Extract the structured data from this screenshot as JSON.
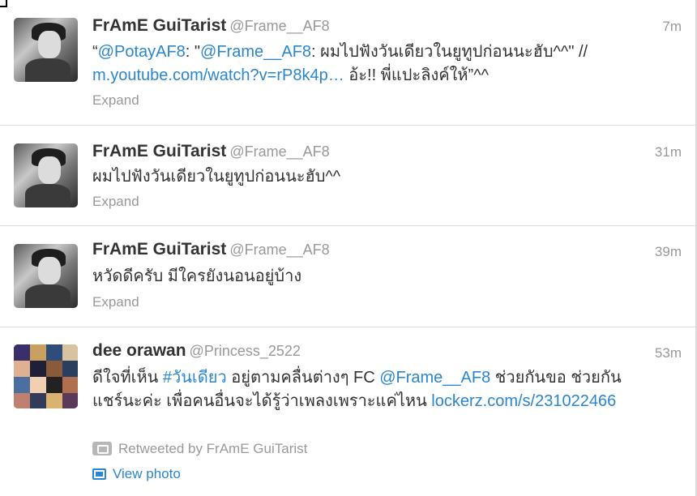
{
  "tweets": [
    {
      "name": "FrAmE GuiTarist",
      "handle": "@Frame__AF8",
      "time": "7m",
      "parts": [
        {
          "t": "“",
          "link": false
        },
        {
          "t": "@PotayAF8",
          "link": true
        },
        {
          "t": ": \"",
          "link": false
        },
        {
          "t": "@Frame__AF8",
          "link": true
        },
        {
          "t": ": ผมไปฟังวันเดียวในยูทูปก่อนนะฮับ^^\" // ",
          "link": false
        },
        {
          "t": "m.youtube.com/watch?v=rP8k4p…",
          "link": true
        },
        {
          "t": " อ้ะ!! พี่แปะลิงค์ให้”^^",
          "link": false
        }
      ],
      "expand": "Expand"
    },
    {
      "name": "FrAmE GuiTarist",
      "handle": "@Frame__AF8",
      "time": "31m",
      "parts": [
        {
          "t": "ผมไปฟังวันเดียวในยูทูปก่อนนะฮับ^^",
          "link": false
        }
      ],
      "expand": "Expand"
    },
    {
      "name": "FrAmE GuiTarist",
      "handle": "@Frame__AF8",
      "time": "39m",
      "parts": [
        {
          "t": "หวัดดีครับ มีใครยังนอนอยู่บ้าง",
          "link": false
        }
      ],
      "expand": "Expand"
    },
    {
      "name": "dee orawan",
      "handle": "@Princess_2522",
      "time": "53m",
      "parts": [
        {
          "t": "ดีใจที่เห็น ",
          "link": false
        },
        {
          "t": "#วันเดียว",
          "link": true
        },
        {
          "t": " อยู่ตามคลื่นต่างๆ FC ",
          "link": false
        },
        {
          "t": "@Frame__AF8",
          "link": true
        },
        {
          "t": " ช่วยกันขอ ช่วยกันแชร์นะค่ะ เพื่อคนอื่นจะได้รู้ว่าเพลงเพราะแค่ไหน ",
          "link": false
        },
        {
          "t": "lockerz.com/s/231022466",
          "link": true
        }
      ],
      "retweeted_by": "Retweeted by FrAmE GuiTarist",
      "view_photo": "View photo"
    }
  ],
  "icons": {
    "retweet": "retweet-icon",
    "photo": "photo-icon"
  },
  "colors": {
    "link": "#2a86d0",
    "name": "#333333",
    "meta": "#999999"
  }
}
